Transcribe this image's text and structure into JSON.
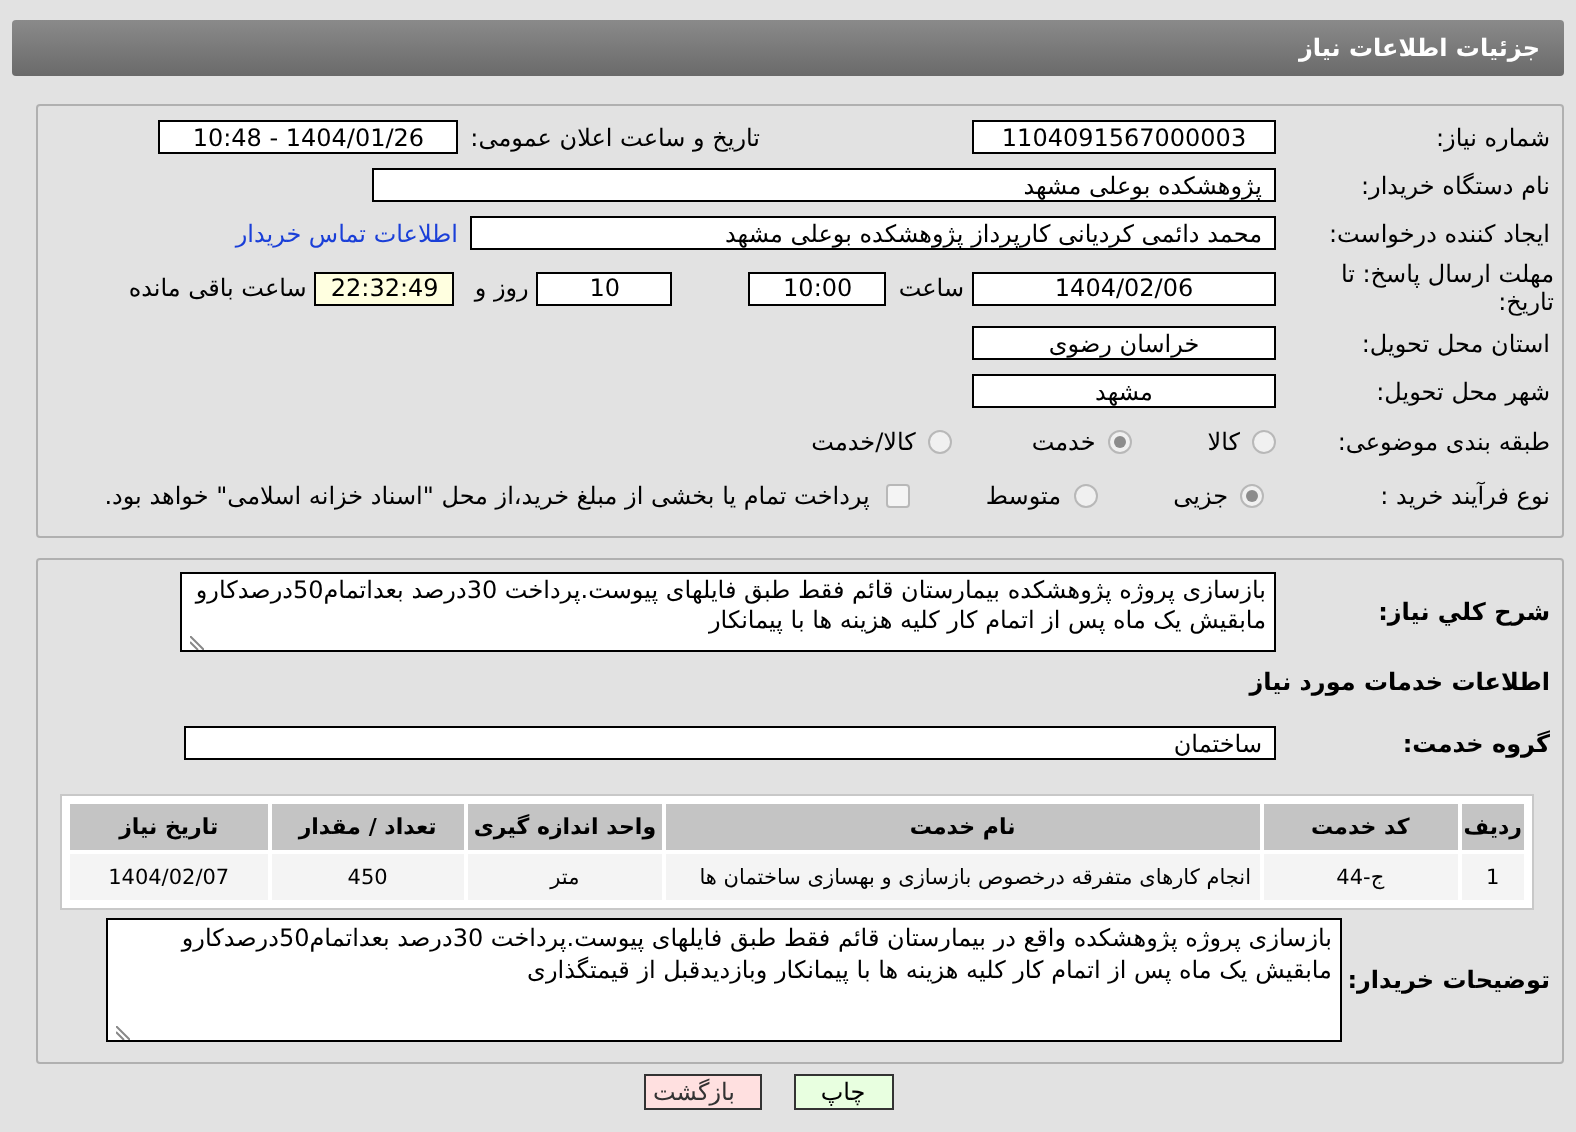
{
  "header": {
    "title": "جزئیات اطلاعات نیاز"
  },
  "need_number": {
    "label": "شماره نیاز:",
    "value": "1104091567000003"
  },
  "announce": {
    "label": "تاریخ و ساعت اعلان عمومی:",
    "value": "1404/01/26 - 10:48"
  },
  "buyer_org": {
    "label": "نام دستگاه خریدار:",
    "value": "پژوهشکده بوعلی  مشهد"
  },
  "requester": {
    "label": "ایجاد کننده درخواست:",
    "value": "محمد دائمی کردیانی کارپرداز پژوهشکده بوعلی  مشهد",
    "link": "اطلاعات تماس خریدار"
  },
  "deadline": {
    "label": "مهلت ارسال پاسخ: تا تاریخ:",
    "date": "1404/02/06",
    "time_label": "ساعت",
    "time": "10:00",
    "days": "10",
    "days_label": "روز و",
    "remaining": "22:32:49",
    "remaining_label": "ساعت باقی مانده"
  },
  "province": {
    "label": "استان محل تحویل:",
    "value": "خراسان رضوی"
  },
  "city": {
    "label": "شهر محل تحویل:",
    "value": "مشهد"
  },
  "category": {
    "label": "طبقه بندی موضوعی:",
    "options": [
      {
        "label": "کالا",
        "selected": false
      },
      {
        "label": "خدمت",
        "selected": true
      },
      {
        "label": "کالا/خدمت",
        "selected": false
      }
    ]
  },
  "purchase_type": {
    "label": "نوع فرآیند خرید :",
    "options": [
      {
        "label": "جزیی",
        "selected": true
      },
      {
        "label": "متوسط",
        "selected": false
      }
    ],
    "payment": {
      "label": "پرداخت تمام یا بخشی از مبلغ خرید،از محل \"اسناد خزانه اسلامی\" خواهد بود.",
      "checked": false
    }
  },
  "description": {
    "label": "شرح کلي نياز:",
    "value": "بازسازی پروژه پژوهشکده بیمارستان قائم فقط طبق فایلهای پیوست.پرداخت 30درصد بعداتمام50درصدکارو مابقیش یک ماه پس از اتمام کار کلیه هزینه ها با پیمانکار"
  },
  "services_heading": "اطلاعات خدمات مورد نیاز",
  "service_group": {
    "label": "گروه خدمت:",
    "value": "ساختمان"
  },
  "table": {
    "columns": [
      "ردیف",
      "کد خدمت",
      "نام خدمت",
      "واحد اندازه گیری",
      "تعداد / مقدار",
      "تاریخ نیاز"
    ],
    "rows": [
      [
        "1",
        "ج-44",
        "انجام کارهای متفرقه درخصوص بازسازی و بهسازی ساختمان ها",
        "متر",
        "450",
        "1404/02/07"
      ]
    ]
  },
  "buyer_notes": {
    "label": "توضیحات خریدار:",
    "value": "بازسازی پروژه پژوهشکده واقع در بیمارستان قائم فقط طبق فایلهای پیوست.پرداخت 30درصد بعداتمام50درصدکارو مابقیش یک ماه پس از اتمام کار کلیه هزینه ها با پیمانکار وبازدیدقبل از قیمتگذاری"
  },
  "buttons": [
    {
      "label": "چاپ",
      "kind": "print"
    },
    {
      "label": "بازگشت",
      "kind": "back"
    }
  ]
}
